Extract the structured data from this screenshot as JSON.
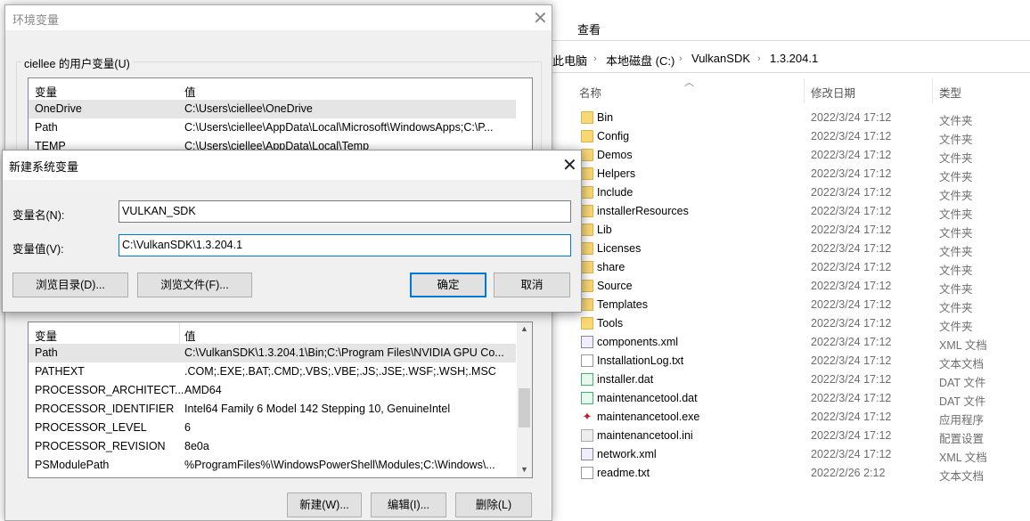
{
  "explorer": {
    "ribbon_tab": "查看",
    "breadcrumb": [
      "此电脑",
      "本地磁盘 (C:)",
      "VulkanSDK",
      "1.3.204.1"
    ],
    "columns": [
      "名称",
      "修改日期",
      "类型"
    ],
    "files": [
      {
        "name": "Bin",
        "date": "2022/3/24 17:12",
        "type": "文件夹",
        "icon": "folder"
      },
      {
        "name": "Config",
        "date": "2022/3/24 17:12",
        "type": "文件夹",
        "icon": "folder"
      },
      {
        "name": "Demos",
        "date": "2022/3/24 17:12",
        "type": "文件夹",
        "icon": "folder"
      },
      {
        "name": "Helpers",
        "date": "2022/3/24 17:12",
        "type": "文件夹",
        "icon": "folder"
      },
      {
        "name": "Include",
        "date": "2022/3/24 17:12",
        "type": "文件夹",
        "icon": "folder"
      },
      {
        "name": "installerResources",
        "date": "2022/3/24 17:12",
        "type": "文件夹",
        "icon": "folder"
      },
      {
        "name": "Lib",
        "date": "2022/3/24 17:12",
        "type": "文件夹",
        "icon": "folder"
      },
      {
        "name": "Licenses",
        "date": "2022/3/24 17:12",
        "type": "文件夹",
        "icon": "folder"
      },
      {
        "name": "share",
        "date": "2022/3/24 17:12",
        "type": "文件夹",
        "icon": "folder"
      },
      {
        "name": "Source",
        "date": "2022/3/24 17:12",
        "type": "文件夹",
        "icon": "folder"
      },
      {
        "name": "Templates",
        "date": "2022/3/24 17:12",
        "type": "文件夹",
        "icon": "folder"
      },
      {
        "name": "Tools",
        "date": "2022/3/24 17:12",
        "type": "文件夹",
        "icon": "folder"
      },
      {
        "name": "components.xml",
        "date": "2022/3/24 17:12",
        "type": "XML 文档",
        "icon": "xml"
      },
      {
        "name": "InstallationLog.txt",
        "date": "2022/3/24 17:12",
        "type": "文本文档",
        "icon": "doc"
      },
      {
        "name": "installer.dat",
        "date": "2022/3/24 17:12",
        "type": "DAT 文件",
        "icon": "dat"
      },
      {
        "name": "maintenancetool.dat",
        "date": "2022/3/24 17:12",
        "type": "DAT 文件",
        "icon": "dat"
      },
      {
        "name": "maintenancetool.exe",
        "date": "2022/3/24 17:12",
        "type": "应用程序",
        "icon": "exe"
      },
      {
        "name": "maintenancetool.ini",
        "date": "2022/3/24 17:12",
        "type": "配置设置",
        "icon": "ini"
      },
      {
        "name": "network.xml",
        "date": "2022/3/24 17:12",
        "type": "XML 文档",
        "icon": "xml"
      },
      {
        "name": "readme.txt",
        "date": "2022/2/26 2:12",
        "type": "文本文档",
        "icon": "doc"
      }
    ]
  },
  "env": {
    "title": "环境变量",
    "user_group": "ciellee 的用户变量(U)",
    "headers": [
      "变量",
      "值"
    ],
    "user_vars": [
      [
        "OneDrive",
        "C:\\Users\\ciellee\\OneDrive"
      ],
      [
        "Path",
        "C:\\Users\\ciellee\\AppData\\Local\\Microsoft\\WindowsApps;C:\\P..."
      ],
      [
        "TEMP",
        "C:\\Users\\ciellee\\AppData\\Local\\Temp"
      ]
    ],
    "sys_vars": [
      [
        "Path",
        "C:\\VulkanSDK\\1.3.204.1\\Bin;C:\\Program Files\\NVIDIA GPU Co..."
      ],
      [
        "PATHEXT",
        ".COM;.EXE;.BAT;.CMD;.VBS;.VBE;.JS;.JSE;.WSF;.WSH;.MSC"
      ],
      [
        "PROCESSOR_ARCHITECT...",
        "AMD64"
      ],
      [
        "PROCESSOR_IDENTIFIER",
        "Intel64 Family 6 Model 142 Stepping 10, GenuineIntel"
      ],
      [
        "PROCESSOR_LEVEL",
        "6"
      ],
      [
        "PROCESSOR_REVISION",
        "8e0a"
      ],
      [
        "PSModulePath",
        "%ProgramFiles%\\WindowsPowerShell\\Modules;C:\\Windows\\..."
      ]
    ],
    "buttons": {
      "new": "新建(W)...",
      "edit": "编辑(I)...",
      "delete": "删除(L)"
    }
  },
  "new_var": {
    "title": "新建系统变量",
    "name_label": "变量名(N):",
    "name_value": "VULKAN_SDK",
    "value_label": "变量值(V):",
    "value_value": "C:\\VulkanSDK\\1.3.204.1",
    "browse_dir": "浏览目录(D)...",
    "browse_file": "浏览文件(F)...",
    "ok": "确定",
    "cancel": "取消"
  },
  "accent": "#0078d7"
}
